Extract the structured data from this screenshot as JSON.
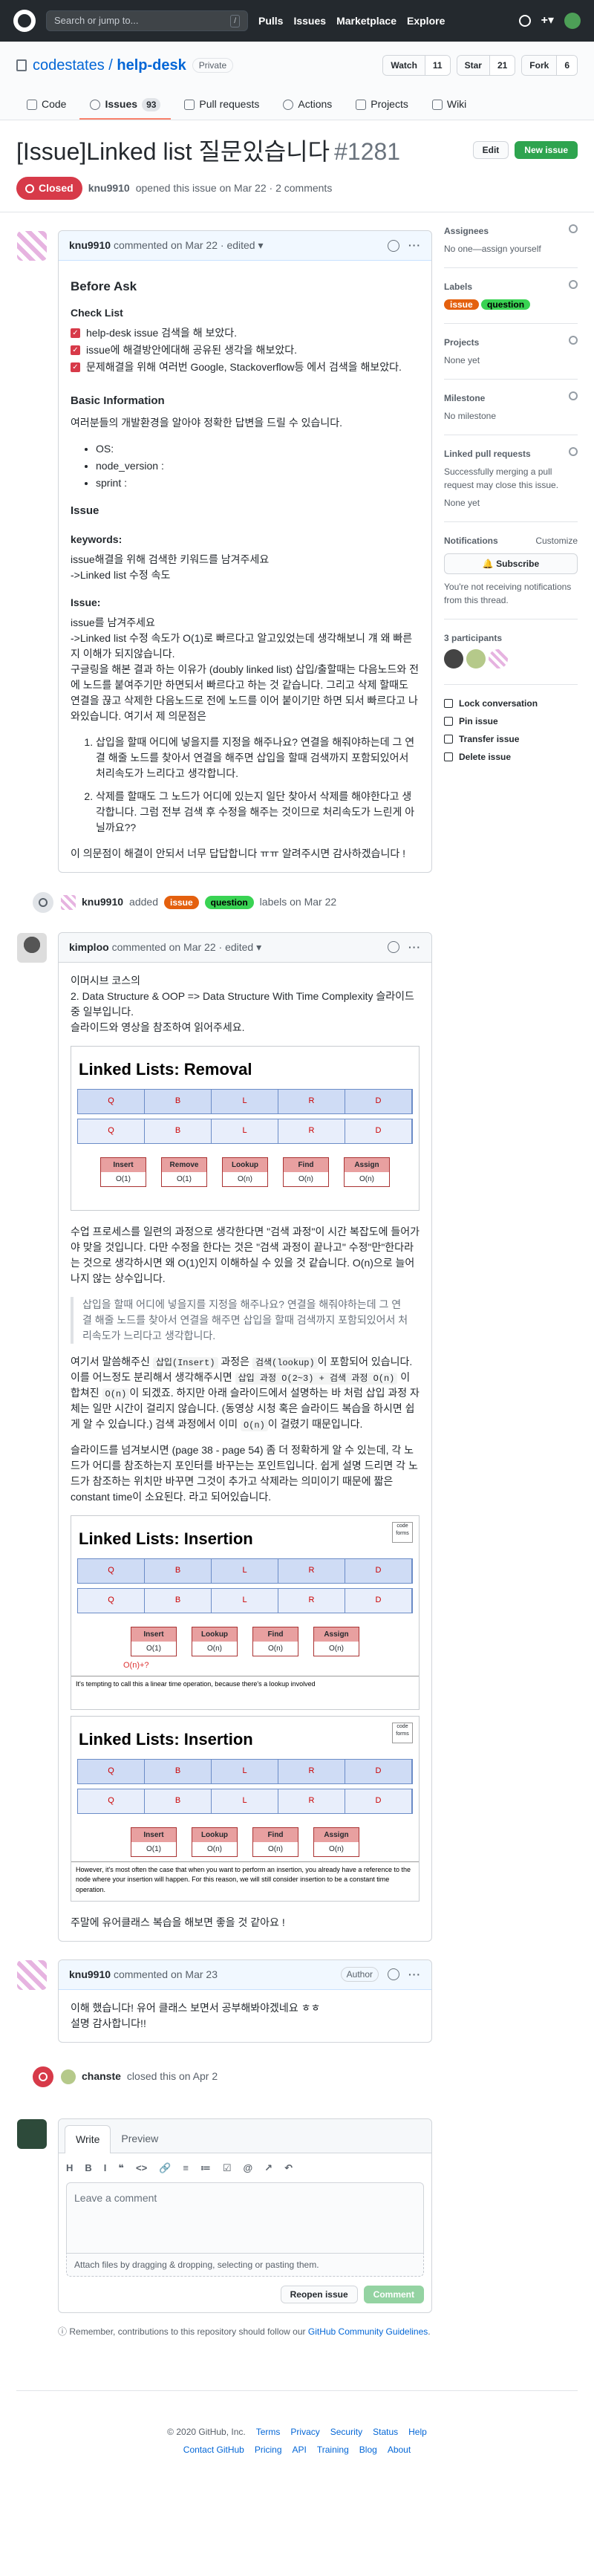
{
  "topbar": {
    "search_placeholder": "Search or jump to...",
    "slash": "/",
    "nav": [
      "Pulls",
      "Issues",
      "Marketplace",
      "Explore"
    ]
  },
  "repo": {
    "owner": "codestates",
    "name": "help-desk",
    "visibility": "Private",
    "watch": "Watch",
    "watch_count": "11",
    "star": "Star",
    "star_count": "21",
    "fork": "Fork",
    "fork_count": "6"
  },
  "tabs": [
    {
      "label": "Code"
    },
    {
      "label": "Issues",
      "count": "93"
    },
    {
      "label": "Pull requests"
    },
    {
      "label": "Actions"
    },
    {
      "label": "Projects"
    },
    {
      "label": "Wiki"
    }
  ],
  "issue": {
    "title": "[Issue]Linked list 질문있습니다",
    "number": "#1281",
    "edit": "Edit",
    "new_issue": "New issue",
    "state": "Closed",
    "meta_user": "knu9910",
    "meta_text": "opened this issue on Mar 22 · 2 comments"
  },
  "comment1": {
    "user": "knu9910",
    "meta": "commented on Mar 22 · edited ▾",
    "h_before": "Before Ask",
    "h_check": "Check List",
    "checks": [
      "help-desk issue 검색을 해 보았다.",
      "issue에 해결방안에대해 공유된 생각을 해보았다.",
      "문제해결을 위해 여러번 Google, Stackoverflow등 에서 검색을 해보았다."
    ],
    "h_basic": "Basic Information",
    "basic_intro": "여러분들의 개발환경을 알아야 정확한 답변을 드릴 수 있습니다.",
    "basic_items": [
      "OS:",
      "node_version :",
      "sprint :"
    ],
    "h_issue": "Issue",
    "kw_label": "keywords:",
    "kw_text1": "issue해결을 위해 검색한 키워드를 남겨주세요",
    "kw_text2": "->Linked list 수정 속도",
    "issue_label": "Issue:",
    "issue_text1": "issue를 남겨주세요",
    "issue_text2": "->Linked list 수정 속도가 O(1)로 빠르다고 알고있었는데 생각해보니 걔 왜 빠른지 이해가 되지않습니다.",
    "issue_text3": "구글링을 해본 결과 하는 이유가 (doubly linked list) 삽입/출할때는 다음노드와 전에 노드를 붙여주기만 하면되서 빠르다고 하는 것 같습니다. 그리고 삭제 할때도 연결을 끊고 삭제한 다음노드로 전에 노드를 이어 붙이기만 하면 되서 빠르다고 나와있습니다. 여기서 제 의문점은",
    "ol": [
      "삽입을 할때 어디에 넣을지를 지정을 해주나요? 연결을 해줘야하는데 그 연결 해줄 노드를 찾아서 연결을 해주면 삽입을 할때 검색까지 포함되있어서 처리속도가 느리다고 생각합니다.",
      "삭제를 할때도 그 노드가 어디에 있는지 일단 찾아서 삭제를 해야한다고 생각합니다. 그럼 전부 검색 후 수정을 해주는 것이므로 처리속도가 느린게 아닐까요??"
    ],
    "closing": "이 의문점이 해결이 안되서 너무 답답합니다 ㅠㅠ 알려주시면 감사하겠습니다 !"
  },
  "label_event": {
    "user": "knu9910",
    "added": "added",
    "label1": "issue",
    "label2": "question",
    "tail": "labels on Mar 22"
  },
  "comment2": {
    "user": "kimploo",
    "meta": "commented on Mar 22 · edited ▾",
    "p1": "이머시브 코스의",
    "p2": "2. Data Structure & OOP => Data Structure With Time Complexity 슬라이드 중 일부입니다.",
    "p3": "슬라이드와 영상을 참조하여 읽어주세요.",
    "slide1_title": "Linked Lists: Removal",
    "slide1_nodes": [
      "Q",
      "B",
      "L",
      "R",
      "D"
    ],
    "slide1_ops": [
      {
        "name": "Insert",
        "cost": "O(1)"
      },
      {
        "name": "Remove",
        "cost": "O(1)"
      },
      {
        "name": "Lookup",
        "cost": "O(n)"
      },
      {
        "name": "Find",
        "cost": "O(n)"
      },
      {
        "name": "Assign",
        "cost": "O(n)"
      }
    ],
    "p4": "수업 프로세스를 일련의 과정으로 생각한다면 \"검색 과정\"이 시간 복잡도에 들어가야 맞을 것입니다. 다만 수정을 한다는 것은 \"검색 과정이 끝나고\" 수정\"만\"한다라는 것으로 생각하시면 왜 O(1)인지 이해하실 수 있을 것 같습니다. O(n)으로 늘어나지 않는 상수입니다.",
    "quote": "삽입을 할때 어디에 넣을지를 지정을 해주나요? 연결을 해줘야하는데 그 연결 해줄 노드를 찾아서 연결을 해주면 삽입을 할때 검색까지 포함되있어서 처리속도가 느리다고 생각합니다.",
    "p5a": "여기서 말씀해주신",
    "p5code1": "삽입(Insert)",
    "p5b": "과정은",
    "p5code2": "검색(lookup)",
    "p5c": "이 포함되어 있습니다. 이를 어느정도 분리해서 생각해주시면",
    "p5code3": "삽입 과정 O(2~3) + 검색 과정 O(n)",
    "p5d": "이 합쳐진",
    "p5code4": "O(n)",
    "p5e": "이 되겠죠. 하지만 아래 슬라이드에서 설명하는 바 처럼 삽입 과정 자체는 일만 시간이 걸리지 않습니다. (동영상 시청 혹은 슬라이드 복습을 하시면 쉽게 알 수 있습니다.) 검색 과정에서 이미",
    "p5code5": "O(n)",
    "p5f": "이 걸렸기 때문입니다.",
    "p6": "슬라이드를 넘겨보시면 (page 38 - page 54) 좀 더 정확하게 알 수 있는데, 각 노드가 어디를 참조하는지 포인터를 바꾸는는 포인트입니다. 쉽게 설명 드리면 각 노드가 참조하는 위치만 바꾸면 그것이 추가고 삭제라는 의미이기 때문에 짧은 constant time이 소요된다. 라고 되어있습니다.",
    "slide2_title": "Linked Lists: Insertion",
    "slide2_code": "code forms",
    "slide2_nodes": [
      "Q",
      "B",
      "L",
      "R",
      "D"
    ],
    "slide2_ops": [
      {
        "name": "Insert",
        "cost": "O(1)"
      },
      {
        "name": "Lookup",
        "cost": "O(n)"
      },
      {
        "name": "Find",
        "cost": "O(n)"
      },
      {
        "name": "Assign",
        "cost": "O(n)"
      }
    ],
    "slide2_hand": "O(n)+?",
    "slide2_note": "It's tempting to call this a linear time operation, because there's a lookup involved",
    "slide3_title": "Linked Lists: Insertion",
    "slide3_ops": [
      {
        "name": "Insert",
        "cost": "O(1)"
      },
      {
        "name": "Lookup",
        "cost": "O(n)"
      },
      {
        "name": "Find",
        "cost": "O(n)"
      },
      {
        "name": "Assign",
        "cost": "O(n)"
      }
    ],
    "slide3_note": "However, it's most often the case that when you want to perform an insertion, you already have a reference to the node where your insertion will happen. For this reason, we will still consider insertion to be a constant time operation.",
    "p7": "주말에 유어클래스 복습을 해보면 좋을 것 같아요 !"
  },
  "comment3": {
    "user": "knu9910",
    "meta": "commented on Mar 23",
    "badge": "Author",
    "text1": "이해 했습니다! 유어 클래스 보면서 공부해봐야겠네요 ㅎㅎ",
    "text2": "설명 감사합니다!!"
  },
  "close_event": {
    "user": "chanste",
    "text": "closed this on Apr 2"
  },
  "composer": {
    "tab_write": "Write",
    "tab_preview": "Preview",
    "tools": [
      "H",
      "B",
      "I",
      "❝",
      "<>",
      "🔗",
      "≡",
      "≔",
      "☑",
      "@",
      "↗",
      "↶"
    ],
    "placeholder": "Leave a comment",
    "attach": "Attach files by dragging & dropping, selecting or pasting them.",
    "reopen": "Reopen issue",
    "comment": "Comment"
  },
  "tip": {
    "text": "Remember, contributions to this repository should follow our",
    "link": "GitHub Community Guidelines",
    "end": "."
  },
  "sidebar": {
    "assignees": "Assignees",
    "assignees_text": "No one—assign yourself",
    "labels": "Labels",
    "label1": "issue",
    "label2": "question",
    "projects": "Projects",
    "projects_text": "None yet",
    "milestone": "Milestone",
    "milestone_text": "No milestone",
    "linked": "Linked pull requests",
    "linked_text": "Successfully merging a pull request may close this issue.",
    "linked_none": "None yet",
    "notifications": "Notifications",
    "customize": "Customize",
    "subscribe": "Subscribe",
    "notif_text": "You're not receiving notifications from this thread.",
    "participants": "3 participants",
    "actions": [
      "Lock conversation",
      "Pin issue",
      "Transfer issue",
      "Delete issue"
    ]
  },
  "footer": {
    "copy": "© 2020 GitHub, Inc.",
    "links1": [
      "Terms",
      "Privacy",
      "Security",
      "Status",
      "Help"
    ],
    "links2": [
      "Contact GitHub",
      "Pricing",
      "API",
      "Training",
      "Blog",
      "About"
    ]
  },
  "colors": {
    "closed": "#d73a49",
    "label_issue": "#e4600e",
    "label_question": "#39d353",
    "green": "#2ea44f"
  }
}
